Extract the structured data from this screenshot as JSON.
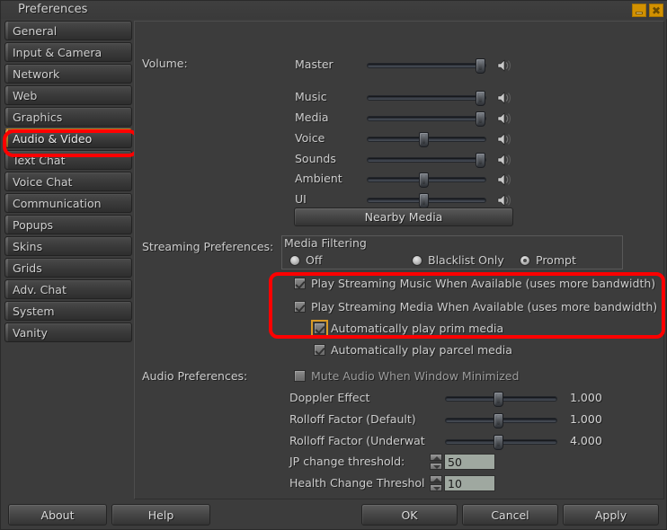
{
  "window": {
    "title": "Preferences",
    "minimize_glyph": "minimize-icon",
    "close_glyph": "close-icon",
    "accent_orange": "#d29100",
    "annotation_color": "#ff0000"
  },
  "sidebar": {
    "items": [
      {
        "label": "General",
        "selected": false
      },
      {
        "label": "Input & Camera",
        "selected": false
      },
      {
        "label": "Network",
        "selected": false
      },
      {
        "label": "Web",
        "selected": false
      },
      {
        "label": "Graphics",
        "selected": false
      },
      {
        "label": "Audio & Video",
        "selected": true
      },
      {
        "label": "Text Chat",
        "selected": false
      },
      {
        "label": "Voice Chat",
        "selected": false
      },
      {
        "label": "Communication",
        "selected": false
      },
      {
        "label": "Popups",
        "selected": false
      },
      {
        "label": "Skins",
        "selected": false
      },
      {
        "label": "Grids",
        "selected": false
      },
      {
        "label": "Adv. Chat",
        "selected": false
      },
      {
        "label": "System",
        "selected": false
      },
      {
        "label": "Vanity",
        "selected": false
      }
    ]
  },
  "volume": {
    "section_label": "Volume:",
    "sliders": [
      {
        "label": "Master",
        "value": 100
      },
      {
        "label": "Music",
        "value": 100
      },
      {
        "label": "Media",
        "value": 100
      },
      {
        "label": "Voice",
        "value": 48
      },
      {
        "label": "Sounds",
        "value": 100
      },
      {
        "label": "Ambient",
        "value": 48
      },
      {
        "label": "UI",
        "value": 48
      }
    ],
    "nearby_media_button": "Nearby Media"
  },
  "streaming": {
    "section_label": "Streaming Preferences:",
    "media_filtering": {
      "title": "Media Filtering",
      "options": [
        {
          "label": "Off",
          "selected": false
        },
        {
          "label": "Blacklist Only",
          "selected": false
        },
        {
          "label": "Prompt",
          "selected": true
        }
      ]
    },
    "checkboxes": [
      {
        "label": "Play Streaming Music When Available (uses more bandwidth)",
        "checked": true,
        "focused": false
      },
      {
        "label": "Play Streaming Media When Available (uses more bandwidth)",
        "checked": true,
        "focused": false
      },
      {
        "label": "Automatically play prim media",
        "checked": true,
        "focused": true
      },
      {
        "label": "Automatically play parcel media",
        "checked": true,
        "focused": false
      }
    ]
  },
  "audio": {
    "section_label": "Audio Preferences:",
    "mute_checkbox": {
      "label": "Mute Audio When Window Minimized",
      "checked": false
    },
    "sliders": [
      {
        "label": "Doppler Effect",
        "value": 48,
        "display": "1.000"
      },
      {
        "label": "Rolloff Factor (Default)",
        "value": 48,
        "display": "1.000"
      },
      {
        "label": "Rolloff Factor (Underwat",
        "value": 48,
        "display": "4.000"
      }
    ],
    "spinners": [
      {
        "label": "JP  change threshold:",
        "value": "50"
      },
      {
        "label": "Health Change Threshol",
        "value": "10"
      }
    ]
  },
  "footer": {
    "about": "About",
    "help": "Help",
    "ok": "OK",
    "cancel": "Cancel",
    "apply": "Apply"
  }
}
